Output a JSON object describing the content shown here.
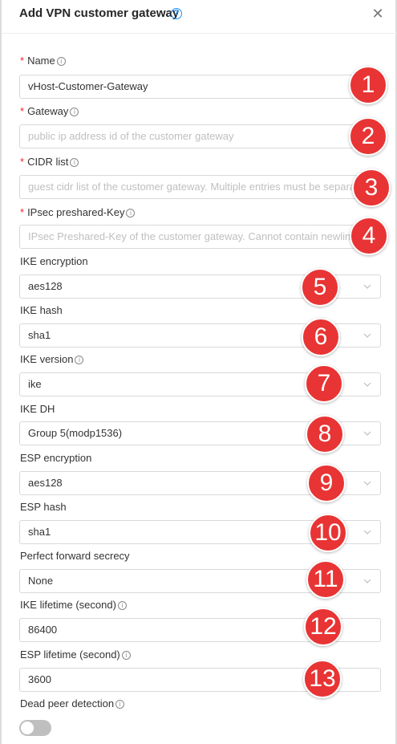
{
  "dialog": {
    "title": "Add VPN customer gateway",
    "help_icon": "?",
    "close_icon": "✕"
  },
  "fields": {
    "name": {
      "label": "Name",
      "required": "*",
      "value": "vHost-Customer-Gateway"
    },
    "gateway": {
      "label": "Gateway",
      "required": "*",
      "placeholder": "public ip address id of the customer gateway"
    },
    "cidr": {
      "label": "CIDR list",
      "required": "*",
      "placeholder": "guest cidr list of the customer gateway. Multiple entries must be separated by a single comma character (,)."
    },
    "ipsec": {
      "label": "IPsec preshared-Key",
      "required": "*",
      "placeholder": "IPsec Preshared-Key of the customer gateway. Cannot contain newline or double quotes."
    },
    "ike_encryption": {
      "label": "IKE encryption",
      "value": "aes128"
    },
    "ike_hash": {
      "label": "IKE hash",
      "value": "sha1"
    },
    "ike_version": {
      "label": "IKE version",
      "value": "ike"
    },
    "ike_dh": {
      "label": "IKE DH",
      "value": "Group 5(modp1536)"
    },
    "esp_encryption": {
      "label": "ESP encryption",
      "value": "aes128"
    },
    "esp_hash": {
      "label": "ESP hash",
      "value": "sha1"
    },
    "pfs": {
      "label": "Perfect forward secrecy",
      "value": "None"
    },
    "ike_lifetime": {
      "label": "IKE lifetime (second)",
      "value": "86400"
    },
    "esp_lifetime": {
      "label": "ESP lifetime (second)",
      "value": "3600"
    },
    "dpd": {
      "label": "Dead peer detection",
      "enabled": false
    }
  },
  "info_glyph": "i",
  "badges": [
    "1",
    "2",
    "3",
    "4",
    "5",
    "6",
    "7",
    "8",
    "9",
    "10",
    "11",
    "12",
    "13"
  ],
  "colors": {
    "accent": "#1890ff",
    "required": "#f5222d",
    "badge": "#e83434",
    "toggle_off": "#bfbfbf"
  }
}
